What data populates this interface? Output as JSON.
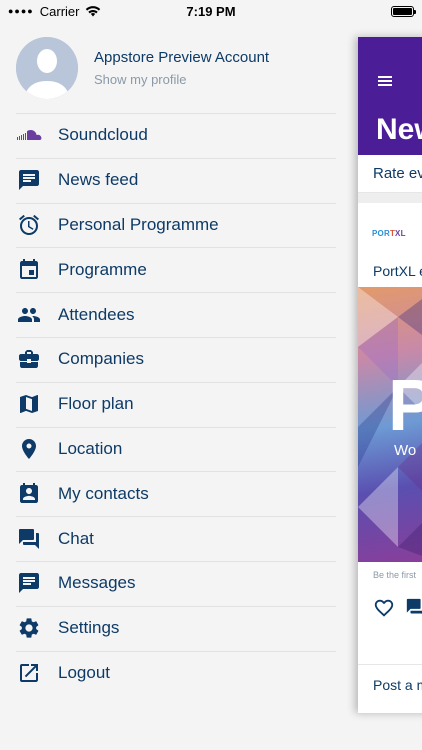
{
  "status_bar": {
    "carrier": "Carrier",
    "time": "7:19 PM"
  },
  "profile": {
    "name": "Appstore Preview Account",
    "link": "Show my profile"
  },
  "menu": [
    {
      "label": "Soundcloud",
      "icon": "soundcloud-icon"
    },
    {
      "label": "News feed",
      "icon": "news-feed-icon"
    },
    {
      "label": "Personal Programme",
      "icon": "alarm-clock-icon"
    },
    {
      "label": "Programme",
      "icon": "calendar-icon"
    },
    {
      "label": "Attendees",
      "icon": "people-icon"
    },
    {
      "label": "Companies",
      "icon": "briefcase-icon"
    },
    {
      "label": "Floor plan",
      "icon": "map-icon"
    },
    {
      "label": "Location",
      "icon": "location-pin-icon"
    },
    {
      "label": "My contacts",
      "icon": "contact-card-icon"
    },
    {
      "label": "Chat",
      "icon": "chat-icon"
    },
    {
      "label": "Messages",
      "icon": "message-icon"
    },
    {
      "label": "Settings",
      "icon": "gear-icon"
    },
    {
      "label": "Logout",
      "icon": "logout-icon"
    }
  ],
  "main": {
    "title": "New",
    "rate_text": "Rate ev",
    "post": {
      "author_logo": "PORTXL",
      "text": "PortXL e",
      "image_letter": "P",
      "image_caption": "Wo",
      "be_first": "Be the first",
      "post_message": "Post a m"
    }
  },
  "colors": {
    "accent": "#4b1e98",
    "text": "#0d3a66",
    "muted": "#8a9aa8"
  }
}
